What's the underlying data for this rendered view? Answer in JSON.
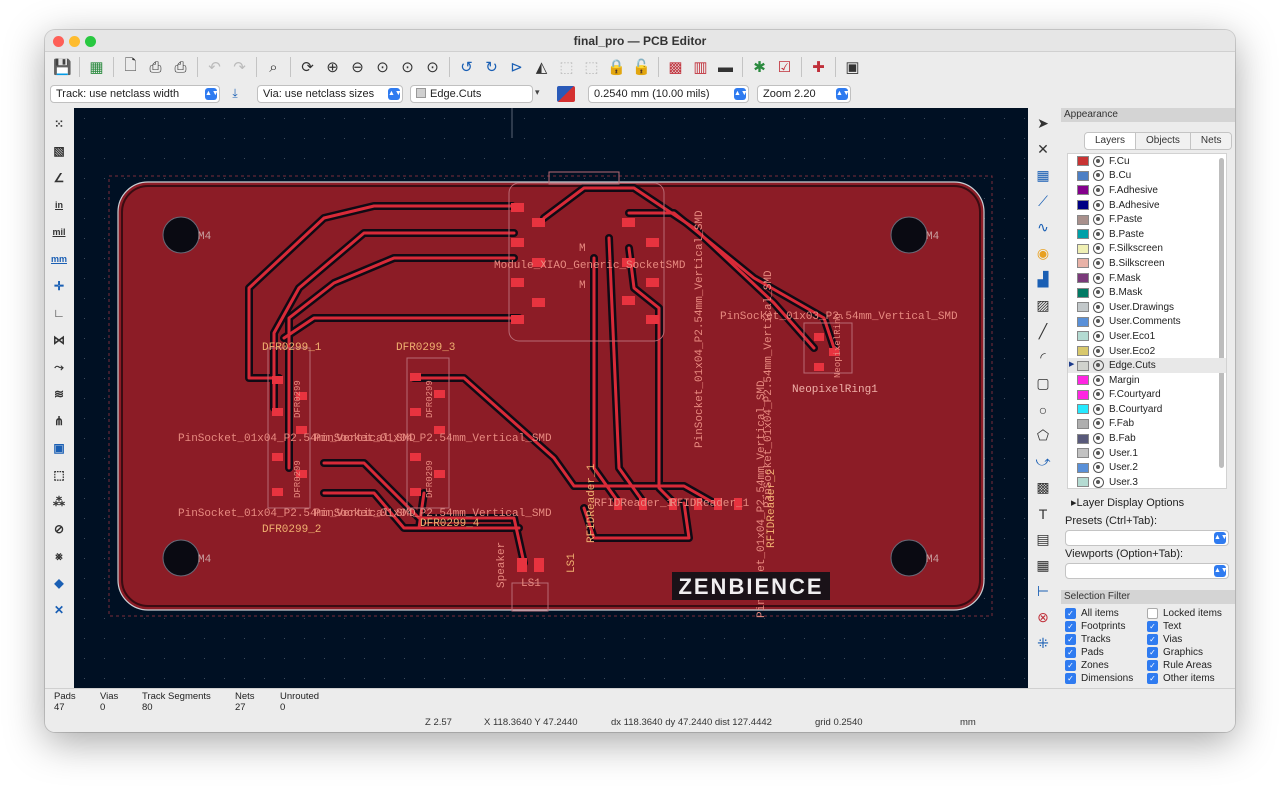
{
  "window": {
    "title": "final_pro — PCB Editor"
  },
  "toolbar": {
    "track_width": "Track: use netclass width",
    "via_size": "Via: use netclass sizes",
    "layer": "Edge.Cuts",
    "grid": "0.2540 mm (10.00 mils)",
    "zoom": "Zoom 2.20"
  },
  "left_tools": {
    "units_in": "in",
    "units_mil": "mil",
    "units_mm": "mm"
  },
  "board": {
    "footprints": {
      "xiao": "Module_XIAO_Generic_SocketSMD",
      "pinsocket_top_right": "PinSocket_01x03_P2.54mm_Vertical_SMD",
      "neopixel": "NeopixelRing1",
      "neopixel_short": "NeopixelRing",
      "dfr1": "DFR0299_1",
      "dfr3": "DFR0299_3",
      "dfr2": "DFR0299_2",
      "dfr4": "DFR0299_4",
      "dfr_fab": "DFR0299",
      "pinsocket_mid_left": "PinSocket_01x04_P2.54mm_Vertical_SMD",
      "pinsocket_mid_overlap": "PinSocket_01x04_P2.54mm_Vertical_SMD",
      "pinsocket_low_left": "PinSocket_01x04_P2.54mm_Vertical_SMD",
      "pinsocket_low_overlap": "PinSocket_01x04_P2.54mm_Vertical_SMD",
      "pinsocket_vert_1": "PinSocket_01x04_P2.54mm_Vertical_SMD",
      "pinsocket_vert_2": "PinSocket_01x04_P2.54mm_Vertical_SMD",
      "pinsocket_vert_3": "PinSocket_01x04_P2.54mm_Vertical_SMD",
      "rfid1": "RFIDReader_1",
      "rfid2": "RFIDReader_2",
      "rfid_fab": "RFIDReader_1",
      "rfid_fab2": "RFIDReader_1",
      "speaker": "Speaker",
      "ls_fab": "LS1",
      "ls_ref": "LS1",
      "mount": "M4",
      "xiao_ref": "M",
      "xiao_ref2": "M"
    },
    "logo": "ZENBIENCE"
  },
  "appearance": {
    "header": "Appearance",
    "tabs": [
      "Layers",
      "Objects",
      "Nets"
    ],
    "layers": [
      {
        "name": "F.Cu",
        "color": "#c83434"
      },
      {
        "name": "B.Cu",
        "color": "#4d7fc4"
      },
      {
        "name": "F.Adhesive",
        "color": "#84008c"
      },
      {
        "name": "B.Adhesive",
        "color": "#000084"
      },
      {
        "name": "F.Paste",
        "color": "#a8908c"
      },
      {
        "name": "B.Paste",
        "color": "#00a0a8"
      },
      {
        "name": "F.Silkscreen",
        "color": "#f0f0b4"
      },
      {
        "name": "B.Silkscreen",
        "color": "#e8b2a7"
      },
      {
        "name": "F.Mask",
        "color": "#7a3a7a"
      },
      {
        "name": "B.Mask",
        "color": "#027a64"
      },
      {
        "name": "User.Drawings",
        "color": "#c2c8ca"
      },
      {
        "name": "User.Comments",
        "color": "#5990d8"
      },
      {
        "name": "User.Eco1",
        "color": "#b4dbd2"
      },
      {
        "name": "User.Eco2",
        "color": "#d8c86c"
      },
      {
        "name": "Edge.Cuts",
        "color": "#d0d2cd"
      },
      {
        "name": "Margin",
        "color": "#ff26e2"
      },
      {
        "name": "F.Courtyard",
        "color": "#ff26e2"
      },
      {
        "name": "B.Courtyard",
        "color": "#26e9ff"
      },
      {
        "name": "F.Fab",
        "color": "#afafaf"
      },
      {
        "name": "B.Fab",
        "color": "#58597a"
      },
      {
        "name": "User.1",
        "color": "#c2c2c2"
      },
      {
        "name": "User.2",
        "color": "#5990d8"
      },
      {
        "name": "User.3",
        "color": "#b4dbd2"
      }
    ],
    "active_layer": "Edge.Cuts",
    "layer_display_options": "Layer Display Options",
    "presets_label": "Presets (Ctrl+Tab):",
    "viewports_label": "Viewports (Option+Tab):"
  },
  "selection_filter": {
    "header": "Selection Filter",
    "items": [
      {
        "label": "All items",
        "checked": true
      },
      {
        "label": "Locked items",
        "checked": false
      },
      {
        "label": "Footprints",
        "checked": true
      },
      {
        "label": "Text",
        "checked": true
      },
      {
        "label": "Tracks",
        "checked": true
      },
      {
        "label": "Vias",
        "checked": true
      },
      {
        "label": "Pads",
        "checked": true
      },
      {
        "label": "Graphics",
        "checked": true
      },
      {
        "label": "Zones",
        "checked": true
      },
      {
        "label": "Rule Areas",
        "checked": true
      },
      {
        "label": "Dimensions",
        "checked": true
      },
      {
        "label": "Other items",
        "checked": true
      }
    ]
  },
  "status": {
    "pads_label": "Pads",
    "pads": "47",
    "vias_label": "Vias",
    "vias": "0",
    "tracks_label": "Track Segments",
    "tracks": "80",
    "nets_label": "Nets",
    "nets": "27",
    "unrouted_label": "Unrouted",
    "unrouted": "0",
    "zoom": "Z 2.57",
    "cursor": "X 118.3640  Y 47.2440",
    "delta": "dx 118.3640  dy 47.2440  dist 127.4442",
    "grid": "grid 0.2540",
    "units": "mm"
  }
}
